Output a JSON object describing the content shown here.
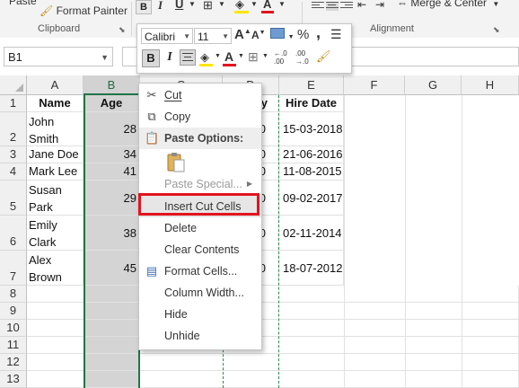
{
  "ribbon": {
    "paste_label": "Paste",
    "format_painter_label": "Format Painter",
    "clipboard_group": "Clipboard",
    "alignment_group": "Alignment",
    "merge_center_label": "Merge & Center",
    "bold_glyph": "B",
    "italic_glyph": "I",
    "underline_glyph": "U"
  },
  "formula_bar": {
    "name_box": "B1"
  },
  "mini_toolbar": {
    "font_name": "Calibri",
    "font_size": "11",
    "grow_font": "A",
    "shrink_font": "A",
    "currency": "$",
    "percent": "%",
    "comma": ",",
    "bold": "B",
    "italic": "I",
    "font_color": "A",
    "inc_decimal": "←.0",
    "inc_decimal_2": ".00",
    "dec_decimal": ".00",
    "dec_decimal_2": "→.0"
  },
  "columns": [
    "A",
    "B",
    "C",
    "D",
    "E",
    "F",
    "G",
    "H"
  ],
  "rows": [
    "1",
    "2",
    "3",
    "4",
    "5",
    "6",
    "7",
    "8",
    "9",
    "10",
    "11",
    "12",
    "13"
  ],
  "table": {
    "headers": {
      "name": "Name",
      "age": "Age",
      "partial_d": "y",
      "hire_date": "Hire Date"
    },
    "records": [
      {
        "name_line1": "John",
        "name_line2": "Smith",
        "age": "28",
        "d_partial": "0",
        "hire_date": "15-03-2018"
      },
      {
        "name": "Jane Doe",
        "age": "34",
        "d_partial": "0",
        "hire_date": "21-06-2016"
      },
      {
        "name": "Mark Lee",
        "age": "41",
        "d_partial": "0",
        "hire_date": "11-08-2015"
      },
      {
        "name_line1": "Susan",
        "name_line2": "Park",
        "age": "29",
        "d_partial": "0",
        "hire_date": "09-02-2017"
      },
      {
        "name_line1": "Emily",
        "name_line2": "Clark",
        "age": "38",
        "d_partial": "0",
        "hire_date": "02-11-2014"
      },
      {
        "name_line1": "Alex",
        "name_line2": "Brown",
        "age": "45",
        "d_partial": "0",
        "hire_date": "18-07-2012"
      }
    ]
  },
  "context_menu": {
    "cut": "Cut",
    "copy": "Copy",
    "paste_options": "Paste Options:",
    "paste_special": "Paste Special...",
    "insert_cut_cells": "Insert Cut Cells",
    "delete": "Delete",
    "clear_contents": "Clear Contents",
    "format_cells": "Format Cells...",
    "column_width": "Column Width...",
    "hide": "Hide",
    "unhide": "Unhide"
  },
  "colors": {
    "excel_green": "#217346",
    "highlight_red": "#e3141e",
    "selected_column": "#d4d4d4",
    "font_color_bar": "#e3141e",
    "fill_color_bar": "#ffe600"
  }
}
